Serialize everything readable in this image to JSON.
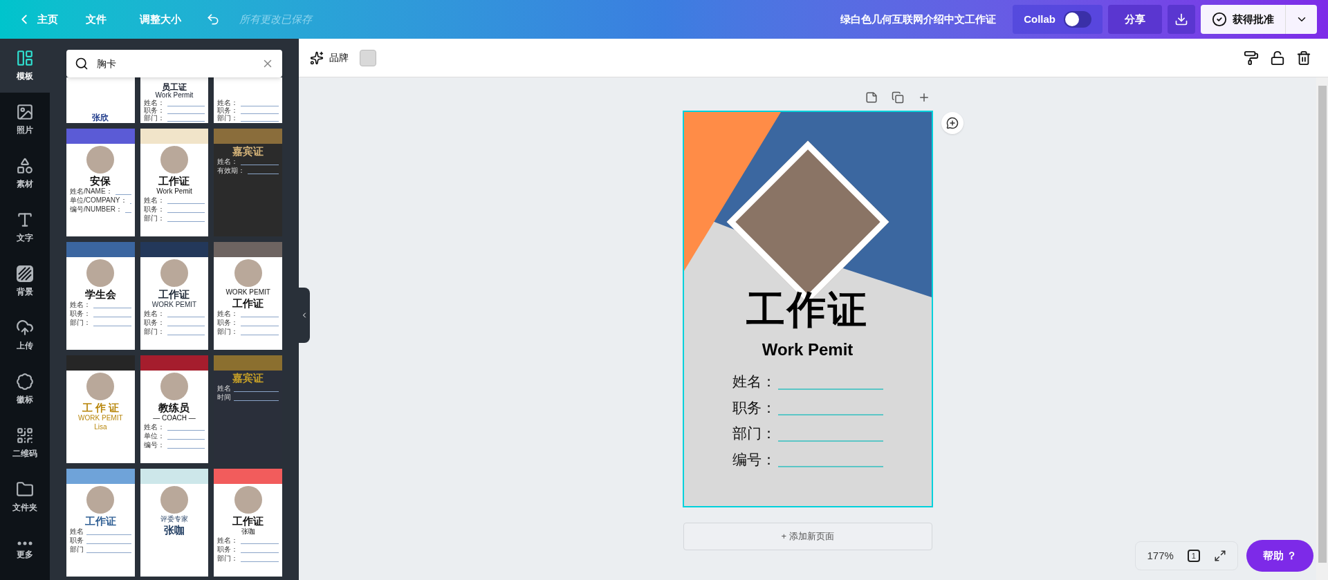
{
  "topbar": {
    "home": "主页",
    "menu": [
      "文件",
      "调整大小"
    ],
    "save_status": "所有更改已保存",
    "doc_title": "绿白色几何互联网介绍中文工作证",
    "collab": {
      "label": "Collab",
      "on": false
    },
    "share": "分享",
    "approve": "获得批准"
  },
  "sidebar": [
    {
      "label": "模板",
      "selected": true
    },
    {
      "label": "照片",
      "selected": false
    },
    {
      "label": "素材",
      "selected": false
    },
    {
      "label": "文字",
      "selected": false
    },
    {
      "label": "背景",
      "selected": false
    },
    {
      "label": "上传",
      "selected": false
    },
    {
      "label": "徽标",
      "selected": false
    },
    {
      "label": "二维码",
      "selected": false
    },
    {
      "label": "文件夹",
      "selected": false
    },
    {
      "label": "更多",
      "selected": false
    }
  ],
  "search": {
    "value": "胸卡"
  },
  "templates": [
    {
      "kind": "wave",
      "texts": [
        {
          "text": "张欣",
          "kind": "title"
        }
      ],
      "photo": false
    },
    {
      "kind": "plain",
      "texts": [
        {
          "text": "员工证",
          "kind": "title"
        },
        {
          "text": "Work Permit",
          "kind": "caption"
        }
      ],
      "fields": [
        "姓名：",
        "职务：",
        "部门："
      ],
      "photo": false
    },
    {
      "kind": "purple",
      "fields": [
        "姓名：",
        "职务：",
        "部门："
      ],
      "photo": false
    },
    {
      "kind": "gradient",
      "texts": [
        {
          "text": "安保",
          "kind": "title"
        }
      ],
      "fields": [
        "姓名/NAME：",
        "单位/COMPANY：",
        "编号/NUMBER："
      ],
      "photo": true
    },
    {
      "kind": "stripes",
      "texts": [
        {
          "text": "工作证",
          "kind": "title"
        },
        {
          "text": "Work Pemit",
          "kind": "caption"
        }
      ],
      "fields": [
        "姓名：",
        "职务：",
        "部门："
      ],
      "photo": true
    },
    {
      "kind": "darkgold",
      "texts": [
        {
          "text": "嘉宾证",
          "kind": "title"
        }
      ],
      "fields": [
        "姓名：",
        "有效期："
      ],
      "photo": false
    },
    {
      "kind": "orange",
      "texts": [
        {
          "text": "学生会",
          "kind": "title"
        }
      ],
      "fields": [
        "姓名：",
        "职务：",
        "部门："
      ],
      "photo": true
    },
    {
      "kind": "navy",
      "texts": [
        {
          "text": "工作证",
          "kind": "title"
        },
        {
          "text": "WORK PEMIT",
          "kind": "caption"
        }
      ],
      "fields": [
        "姓名：",
        "职务：",
        "部门："
      ],
      "photo": true
    },
    {
      "kind": "brown",
      "texts": [
        {
          "text": "WORK PEMIT",
          "kind": "caption"
        },
        {
          "text": "工作证",
          "kind": "title"
        }
      ],
      "fields": [
        "姓名：",
        "职务：",
        "部门："
      ],
      "photo": true
    },
    {
      "kind": "blackgold",
      "texts": [
        {
          "text": "工 作 证",
          "kind": "title"
        },
        {
          "text": "WORK PEMIT",
          "kind": "caption"
        },
        {
          "text": "Lisa",
          "kind": "caption"
        }
      ],
      "photo": true
    },
    {
      "kind": "red",
      "texts": [
        {
          "text": "教练员",
          "kind": "title"
        },
        {
          "text": "— COACH —",
          "kind": "caption"
        }
      ],
      "fields": [
        "姓名：",
        "单位：",
        "编号："
      ],
      "photo": true
    },
    {
      "kind": "darkband",
      "texts": [
        {
          "text": "嘉宾证",
          "kind": "title"
        }
      ],
      "fields": [
        "姓名",
        "时间"
      ],
      "photo": false
    },
    {
      "kind": "lightblue",
      "texts": [
        {
          "text": "工作证",
          "kind": "title"
        }
      ],
      "fields": [
        "姓名",
        "职务",
        "部门"
      ],
      "photo": true
    },
    {
      "kind": "brush",
      "texts": [
        {
          "text": "评委专家",
          "kind": "caption"
        },
        {
          "text": "张咖",
          "kind": "title"
        }
      ],
      "photo": true
    },
    {
      "kind": "coral",
      "texts": [
        {
          "text": "工作证",
          "kind": "title"
        },
        {
          "text": "张咖",
          "kind": "caption"
        }
      ],
      "fields": [
        "姓名：",
        "职务：",
        "部门："
      ],
      "photo": true
    }
  ],
  "toolbar": {
    "brand": "品牌"
  },
  "card": {
    "title": "工作证",
    "subtitle": "Work Pemit",
    "fields": [
      "姓名：",
      "职务：",
      "部门：",
      "编号："
    ]
  },
  "add_page": "+ 添加新页面",
  "zoom": "177%",
  "page_count": "1",
  "help": "帮助 ？"
}
